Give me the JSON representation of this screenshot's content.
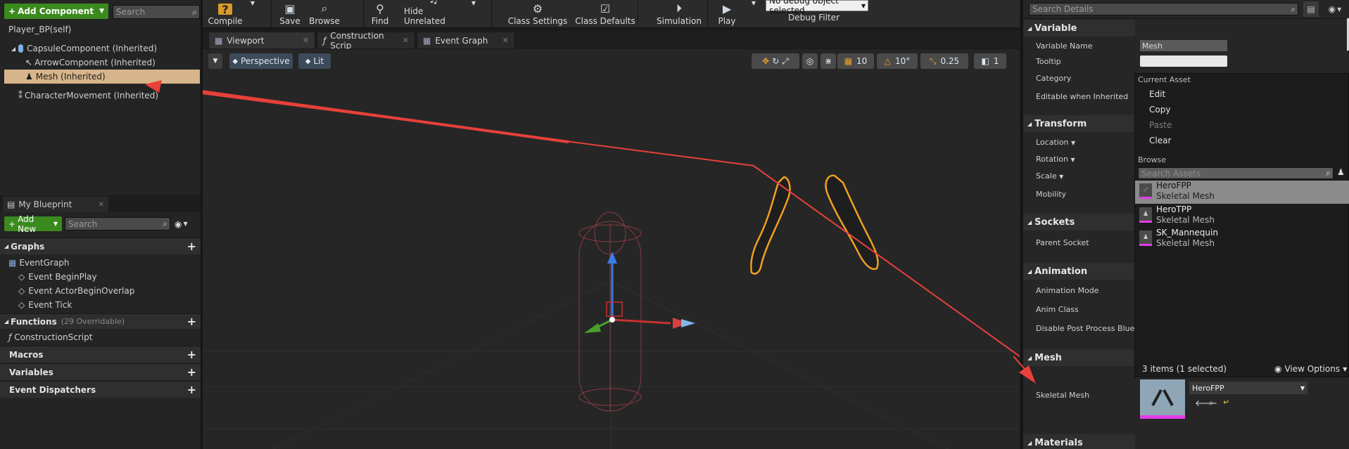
{
  "components": {
    "add_button": "Add Component",
    "search_placeholder": "Search",
    "root": "Player_BP(self)",
    "capsule": "CapsuleComponent (Inherited)",
    "arrow": "ArrowComponent (Inherited)",
    "mesh": "Mesh (Inherited)",
    "movement": "CharacterMovement (Inherited)"
  },
  "my_blueprint": {
    "tab": "My Blueprint",
    "add_new": "Add New",
    "search_placeholder": "Search",
    "graphs": "Graphs",
    "event_graph": "EventGraph",
    "events": [
      "Event BeginPlay",
      "Event ActorBeginOverlap",
      "Event Tick"
    ],
    "functions": "Functions",
    "functions_count": "(29 Overridable)",
    "construction": "ConstructionScript",
    "macros": "Macros",
    "variables": "Variables",
    "dispatchers": "Event Dispatchers"
  },
  "toolbar": {
    "compile": "Compile",
    "save": "Save",
    "browse": "Browse",
    "find": "Find",
    "hide_unrelated": "Hide Unrelated",
    "class_settings": "Class Settings",
    "class_defaults": "Class Defaults",
    "simulation": "Simulation",
    "play": "Play",
    "debug_object": "No debug object selected",
    "debug_filter": "Debug Filter"
  },
  "tabs": [
    "Viewport",
    "Construction Scrip",
    "Event Graph"
  ],
  "viewport": {
    "perspective": "Perspective",
    "lit": "Lit",
    "grid_snap": "10",
    "rot_snap": "10°",
    "scale_snap": "0.25",
    "camera_speed": "1"
  },
  "details": {
    "search_placeholder": "Search Details",
    "variable": "Variable",
    "variable_name_label": "Variable Name",
    "variable_name_value": "Mesh",
    "tooltip_label": "Tooltip",
    "category_label": "Category",
    "editable_label": "Editable when Inherited",
    "transform": "Transform",
    "location": "Location",
    "rotation": "Rotation",
    "scale": "Scale",
    "mobility": "Mobility",
    "sockets": "Sockets",
    "parent_socket": "Parent Socket",
    "animation": "Animation",
    "animation_mode": "Animation Mode",
    "anim_class": "Anim Class",
    "disable_post": "Disable Post Process Bluepr",
    "mesh": "Mesh",
    "skeletal_mesh_label": "Skeletal Mesh",
    "skeletal_mesh_value": "HeroFPP",
    "materials": "Materials"
  },
  "popup": {
    "current_asset": "Current Asset",
    "edit": "Edit",
    "copy": "Copy",
    "paste": "Paste",
    "clear": "Clear",
    "browse": "Browse",
    "search_placeholder": "Search Assets",
    "assets": [
      {
        "name": "HeroFPP",
        "type": "Skeletal Mesh"
      },
      {
        "name": "HeroTPP",
        "type": "Skeletal Mesh"
      },
      {
        "name": "SK_Mannequin",
        "type": "Skeletal Mesh"
      }
    ],
    "count": "3 items (1 selected)",
    "view_options": "View Options"
  },
  "colors": {
    "accent_green": "#3a8a1e",
    "selection": "#d7b58a",
    "annotation_arrow": "#e8403a",
    "mesh_outline": "#f0a020"
  }
}
